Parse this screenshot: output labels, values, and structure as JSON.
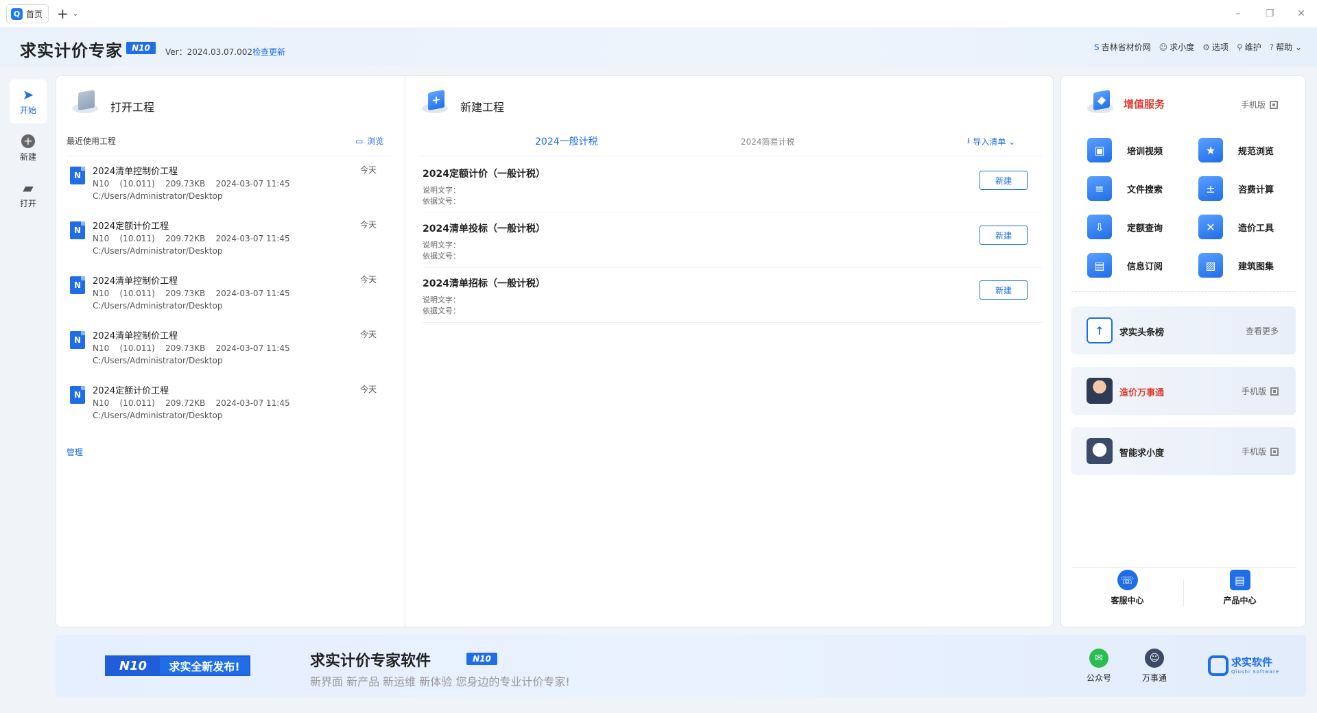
{
  "tabbar": {
    "home_tab": "首页",
    "logo_letter": "Q",
    "add": "+",
    "caret": "⌄"
  },
  "window_controls": {
    "minimize": "–",
    "restore": "❐",
    "close": "✕"
  },
  "header": {
    "title": "求实计价专家",
    "badge": "N10",
    "version": "Ver：2024.03.07.002",
    "check_update": "检查更新",
    "links": [
      {
        "icon": "price-site-icon",
        "label": "吉林省材价网"
      },
      {
        "icon": "robot-icon",
        "label": "求小度"
      },
      {
        "icon": "gear-icon",
        "label": "选项"
      },
      {
        "icon": "wrench-icon",
        "label": "维护"
      },
      {
        "icon": "help-icon",
        "label": "帮助 ⌄"
      }
    ]
  },
  "rail": {
    "items": [
      {
        "icon": "send-icon",
        "label": "开始",
        "active": true
      },
      {
        "icon": "plus-circle-icon",
        "label": "新建"
      },
      {
        "icon": "folder-icon",
        "label": "打开"
      }
    ]
  },
  "open_project": {
    "title": "打开工程",
    "recent_label": "最近使用工程",
    "browse": "浏览",
    "manage": "管理",
    "items": [
      {
        "name": "2024清单控制价工程",
        "date": "今天",
        "meta": "N10    (10.011)    209.73KB    2024-03-07 11:45",
        "path": "C:/Users/Administrator/Desktop"
      },
      {
        "name": "2024定额计价工程",
        "date": "今天",
        "meta": "N10    (10.011)    209.72KB    2024-03-07 11:45",
        "path": "C:/Users/Administrator/Desktop"
      },
      {
        "name": "2024清单控制价工程",
        "date": "今天",
        "meta": "N10    (10.011)    209.73KB    2024-03-07 11:45",
        "path": "C:/Users/Administrator/Desktop"
      },
      {
        "name": "2024清单控制价工程",
        "date": "今天",
        "meta": "N10    (10.011)    209.73KB    2024-03-07 11:45",
        "path": "C:/Users/Administrator/Desktop"
      },
      {
        "name": "2024定额计价工程",
        "date": "今天",
        "meta": "N10    (10.011)    209.72KB    2024-03-07 11:45",
        "path": "C:/Users/Administrator/Desktop"
      }
    ],
    "file_icon_letter": "N"
  },
  "new_project": {
    "title": "新建工程",
    "tab_general": "2024一般计税",
    "tab_simple": "2024简易计税",
    "import": "导入清单",
    "templates": [
      {
        "name": "2024定额计价（一般计税）",
        "desc": "说明文字：",
        "basis": "依据文号：",
        "button": "新建"
      },
      {
        "name": "2024清单投标（一般计税）",
        "desc": "说明文字：",
        "basis": "依据文号：",
        "button": "新建"
      },
      {
        "name": "2024清单招标（一般计税）",
        "desc": "说明文字：",
        "basis": "依据文号：",
        "button": "新建"
      }
    ]
  },
  "value_added": {
    "title": "增值服务",
    "mobile": "手机版",
    "services": [
      {
        "icon": "video-icon",
        "glyph": "▣",
        "label": "培训视频"
      },
      {
        "icon": "spec-icon",
        "glyph": "★",
        "label": "规范浏览"
      },
      {
        "icon": "file-search-icon",
        "glyph": "≡",
        "label": "文件搜索"
      },
      {
        "icon": "calculator-icon",
        "glyph": "±",
        "label": "咨费计算"
      },
      {
        "icon": "quota-icon",
        "glyph": "⇩",
        "label": "定额查询"
      },
      {
        "icon": "tools-icon",
        "glyph": "✕",
        "label": "造价工具"
      },
      {
        "icon": "subscribe-icon",
        "glyph": "▤",
        "label": "信息订阅"
      },
      {
        "icon": "atlas-icon",
        "glyph": "▨",
        "label": "建筑图集"
      }
    ],
    "promos": [
      {
        "icon": "headline-icon",
        "title": "求实头条榜",
        "right": "查看更多",
        "red": false,
        "qr": false
      },
      {
        "icon": "agent-hot-icon",
        "title": "造价万事通",
        "right": "手机版",
        "red": true,
        "qr": true
      },
      {
        "icon": "robot-icon",
        "title": "智能求小度",
        "right": "手机版",
        "red": false,
        "qr": true
      }
    ],
    "bottom": [
      {
        "icon": "customer-service-icon",
        "label": "客服中心"
      },
      {
        "icon": "product-center-icon",
        "label": "产品中心"
      }
    ]
  },
  "banner": {
    "badge_n10": "N10",
    "badge_text": "求实全新发布!",
    "title": "求实计价专家软件",
    "title_badge": "N10",
    "subtitle": "新界面 新产品 新运维 新体验 您身边的专业计价专家!",
    "links": [
      {
        "icon": "wechat-icon",
        "label": "公众号",
        "color": "#2bbd52"
      },
      {
        "icon": "robot-icon",
        "label": "万事通",
        "color": "#3b4a66"
      }
    ],
    "brand": "求实软件",
    "brand_en": "Qiushi  Software"
  },
  "colors": {
    "accent": "#1f6ee8",
    "red": "#e23b2e"
  }
}
